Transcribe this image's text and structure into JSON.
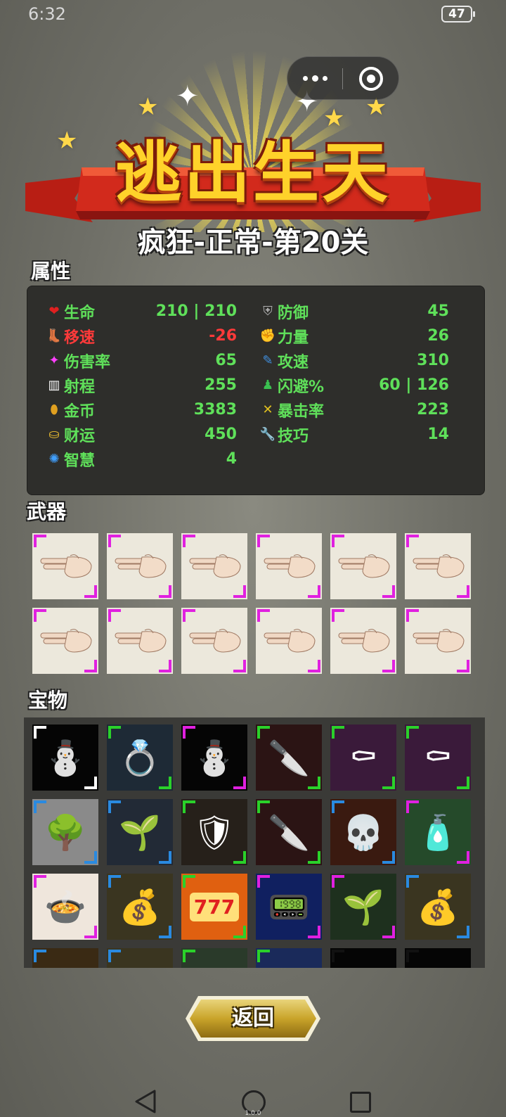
{
  "status": {
    "time": "6:32",
    "battery": "47"
  },
  "capsule": {
    "more_icon": "more-dots-icon",
    "close_icon": "target-close-icon"
  },
  "header": {
    "title": "逃出生天",
    "subtitle": "疯狂-正常-第20关"
  },
  "attributes": {
    "section_title": "属性",
    "left": [
      {
        "icon": "heart-icon",
        "label": "生命",
        "value": "210 | 210",
        "color": "green"
      },
      {
        "icon": "boot-icon",
        "label": "移速",
        "value": "-26",
        "color": "red"
      },
      {
        "icon": "sparkle-icon",
        "label": "伤害率",
        "value": "65",
        "color": "green"
      },
      {
        "icon": "ruler-icon",
        "label": "射程",
        "value": "255",
        "color": "green"
      },
      {
        "icon": "coin-icon",
        "label": "金币",
        "value": "3383",
        "color": "green"
      },
      {
        "icon": "ingot-icon",
        "label": "财运",
        "value": "450",
        "color": "green"
      },
      {
        "icon": "brain-icon",
        "label": "智慧",
        "value": "4",
        "color": "green"
      }
    ],
    "right": [
      {
        "icon": "shield-icon",
        "label": "防御",
        "value": "45",
        "color": "green"
      },
      {
        "icon": "muscle-icon",
        "label": "力量",
        "value": "26",
        "color": "green"
      },
      {
        "icon": "feather-icon",
        "label": "攻速",
        "value": "310",
        "color": "green"
      },
      {
        "icon": "figure-icon",
        "label": "闪避%",
        "value": "60 | 126",
        "color": "green"
      },
      {
        "icon": "crit-icon",
        "label": "暴击率",
        "value": "223",
        "color": "green"
      },
      {
        "icon": "wrench-icon",
        "label": "技巧",
        "value": "14",
        "color": "green"
      }
    ]
  },
  "weapons": {
    "section_title": "武器",
    "items": [
      {
        "icon": "finger-gun-icon",
        "rarity": "#e020e0"
      },
      {
        "icon": "finger-gun-icon",
        "rarity": "#e020e0"
      },
      {
        "icon": "finger-gun-icon",
        "rarity": "#e020e0"
      },
      {
        "icon": "finger-gun-icon",
        "rarity": "#e020e0"
      },
      {
        "icon": "finger-gun-icon",
        "rarity": "#e020e0"
      },
      {
        "icon": "finger-gun-icon",
        "rarity": "#e020e0"
      },
      {
        "icon": "finger-gun-icon",
        "rarity": "#e020e0"
      },
      {
        "icon": "finger-gun-icon",
        "rarity": "#e020e0"
      },
      {
        "icon": "finger-gun-icon",
        "rarity": "#e020e0"
      },
      {
        "icon": "finger-gun-icon",
        "rarity": "#e020e0"
      },
      {
        "icon": "finger-gun-icon",
        "rarity": "#e020e0"
      },
      {
        "icon": "finger-gun-icon",
        "rarity": "#e020e0"
      }
    ]
  },
  "treasures": {
    "section_title": "宝物",
    "items": [
      {
        "icon": "snowman-icon",
        "glyph": "⛄",
        "rarity": "#ffffff",
        "bg": "#050505"
      },
      {
        "icon": "leaf-ring-icon",
        "glyph": "💍",
        "rarity": "#2ad12a",
        "bg": "#1e2a36"
      },
      {
        "icon": "snowman-icon",
        "glyph": "⛄",
        "rarity": "#e020e0",
        "bg": "#050505"
      },
      {
        "icon": "blade-icon",
        "glyph": "🔪",
        "rarity": "#2ad12a",
        "bg": "#2b1414"
      },
      {
        "icon": "coffin-icon",
        "glyph": "⚰",
        "rarity": "#2ad12a",
        "bg": "#3a1a3a"
      },
      {
        "icon": "coffin-icon",
        "glyph": "⚰",
        "rarity": "#2ad12a",
        "bg": "#3a1a3a"
      },
      {
        "icon": "bonsai-icon",
        "glyph": "🌳",
        "rarity": "#2a8ae0",
        "bg": "#8a8a8a"
      },
      {
        "icon": "bean-sprout-icon",
        "glyph": "🌱",
        "rarity": "#2a8ae0",
        "bg": "#222a36"
      },
      {
        "icon": "wooden-shield-icon",
        "glyph": "🛡",
        "rarity": "#2ad12a",
        "bg": "#26201a"
      },
      {
        "icon": "blade-icon",
        "glyph": "🔪",
        "rarity": "#2ad12a",
        "bg": "#2b1414"
      },
      {
        "icon": "skull-mask-icon",
        "glyph": "💀",
        "rarity": "#2a8ae0",
        "bg": "#3a1a10"
      },
      {
        "icon": "spray-can-icon",
        "glyph": "🧴",
        "rarity": "#e020e0",
        "bg": "#254a2a"
      },
      {
        "icon": "hot-dish-icon",
        "glyph": "🍲",
        "rarity": "#e020e0",
        "bg": "#efe6dc"
      },
      {
        "icon": "gold-pot-icon",
        "glyph": "💰",
        "rarity": "#2a8ae0",
        "bg": "#3a3520"
      },
      {
        "icon": "slot-machine-icon",
        "glyph": "777",
        "rarity": "#2ad12a",
        "bg": "#e06010"
      },
      {
        "icon": "calculator-icon",
        "glyph": "📟",
        "rarity": "#e020e0",
        "bg": "#102060"
      },
      {
        "icon": "seed-bag-icon",
        "glyph": "🌱",
        "rarity": "#e020e0",
        "bg": "#1e301e"
      },
      {
        "icon": "gold-pot-icon",
        "glyph": "💰",
        "rarity": "#2a8ae0",
        "bg": "#3a3520"
      },
      {
        "icon": "partial-item-icon",
        "glyph": "",
        "rarity": "#2a8ae0",
        "bg": "#3a2a14"
      },
      {
        "icon": "partial-item-icon",
        "glyph": "",
        "rarity": "#2a8ae0",
        "bg": "#3a3520"
      },
      {
        "icon": "partial-item-icon",
        "glyph": "",
        "rarity": "#2ad12a",
        "bg": "#2a3a2a"
      },
      {
        "icon": "partial-item-icon",
        "glyph": "",
        "rarity": "#2ad12a",
        "bg": "#1a2a5a"
      },
      {
        "icon": "partial-item-icon",
        "glyph": "",
        "rarity": "#111111",
        "bg": "#050505"
      },
      {
        "icon": "partial-item-icon",
        "glyph": "",
        "rarity": "#111111",
        "bg": "#050505"
      }
    ]
  },
  "back_button": {
    "label": "返回"
  },
  "nav": {
    "version": "1.0.0"
  }
}
